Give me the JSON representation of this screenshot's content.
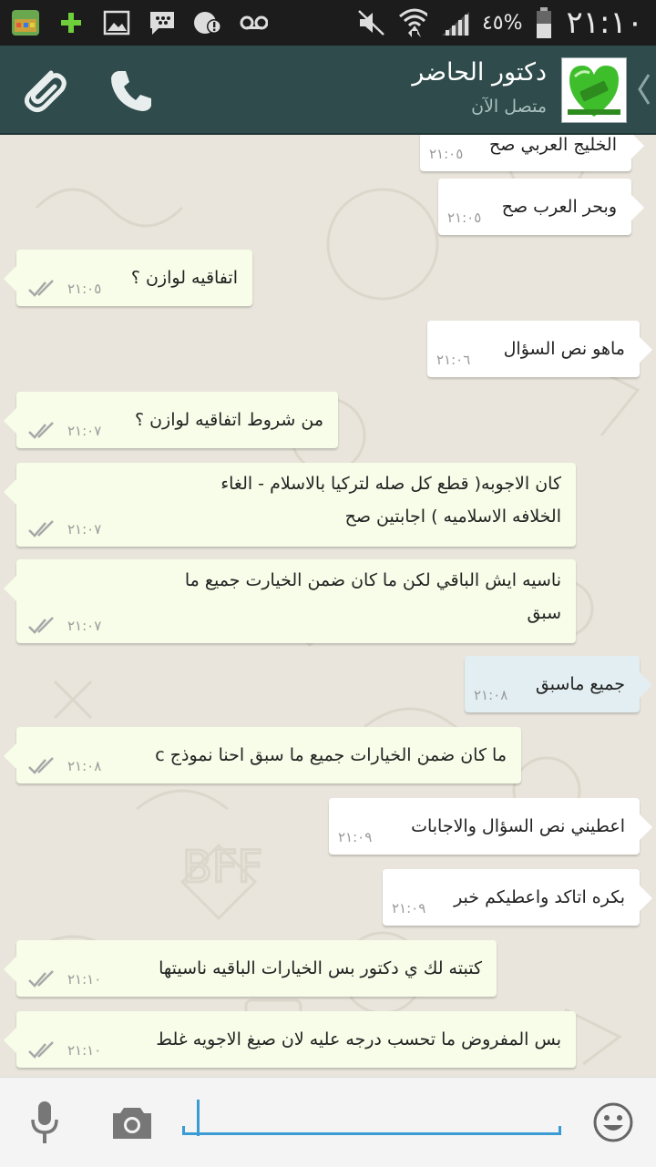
{
  "status_bar": {
    "battery_percent": "٤٥%",
    "time": "٢١:١٠",
    "notification_icons": [
      "app-icon",
      "plus-icon",
      "image-icon",
      "bbm-icon",
      "alert-icon",
      "voicemail-icon"
    ],
    "system_icons": [
      "mute-icon",
      "wifi-icon",
      "signal-icon",
      "battery-icon"
    ]
  },
  "header": {
    "contact_name": "دكتور الحاضر",
    "contact_status": "متصل الآن",
    "buttons": [
      "attach-icon",
      "call-icon"
    ],
    "accent_color": "#2f4b4b"
  },
  "messages": [
    {
      "text": [
        "الخليج العربي صح"
      ],
      "time": "٢١:٠٥",
      "direction": "incoming",
      "ticks": false
    },
    {
      "text": [
        "وبحر العرب صح"
      ],
      "time": "٢١:٠٥",
      "direction": "incoming",
      "ticks": false
    },
    {
      "text": [
        "اتفاقيه لوازن ؟"
      ],
      "time": "٢١:٠٥",
      "direction": "outgoing",
      "ticks": true
    },
    {
      "text": [
        "ماهو نص السؤال"
      ],
      "time": "٢١:٠٦",
      "direction": "incoming",
      "ticks": false
    },
    {
      "text": [
        "من شروط اتفاقيه لوازن ؟"
      ],
      "time": "٢١:٠٧",
      "direction": "outgoing",
      "ticks": true
    },
    {
      "text": [
        "كان الاجوبه(  قطع كل صله لتركيا بالاسلام - الغاء",
        "الخلافه الاسلاميه ) اجابتين صح"
      ],
      "time": "٢١:٠٧",
      "direction": "outgoing",
      "ticks": true
    },
    {
      "text": [
        "ناسيه ايش الباقي لكن ما كان ضمن الخيارت جميع ما",
        "سبق"
      ],
      "time": "٢١:٠٧",
      "direction": "outgoing",
      "ticks": true
    },
    {
      "text": [
        "جميع ماسبق"
      ],
      "time": "٢١:٠٨",
      "direction": "incoming",
      "ticks": false,
      "selected": true
    },
    {
      "text": [
        "ما كان ضمن الخيارات جميع ما سبق احنا نموذج c"
      ],
      "time": "٢١:٠٨",
      "direction": "outgoing",
      "ticks": true
    },
    {
      "text": [
        "اعطيني نص السؤال والاجابات"
      ],
      "time": "٢١:٠٩",
      "direction": "incoming",
      "ticks": false
    },
    {
      "text": [
        "بكره اتاكد واعطيكم خبر"
      ],
      "time": "٢١:٠٩",
      "direction": "incoming",
      "ticks": false
    },
    {
      "text": [
        "كتبته لك ي دكتور بس الخيارات الباقيه ناسيتها"
      ],
      "time": "٢١:١٠",
      "direction": "outgoing",
      "ticks": true
    },
    {
      "text": [
        "بس المفروض ما تحسب درجه عليه لان صيغ الاجويه غلط"
      ],
      "time": "٢١:١٠",
      "direction": "outgoing",
      "ticks": true
    }
  ],
  "input_bar": {
    "icons": [
      "emoji-icon",
      "camera-icon",
      "microphone-icon"
    ],
    "text_value": "",
    "accent_color": "#3a9bd5"
  }
}
